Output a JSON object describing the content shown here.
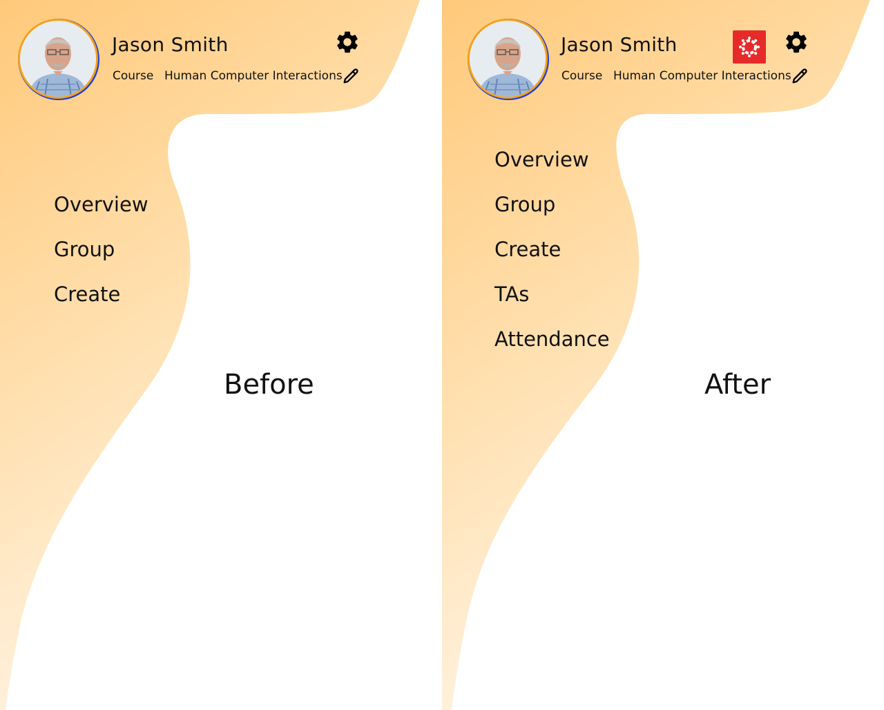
{
  "colors": {
    "gradient_top": "#ffc97a",
    "gradient_bottom": "#fff6ea",
    "avatar_ring": "#f4a21a",
    "avatar_shadow": "#1f3fd9",
    "canvas_red": "#e62a2a",
    "text": "#111111"
  },
  "before": {
    "profile": {
      "name": "Jason Smith",
      "course_label": "Course",
      "course_value": "Human Computer Interactions"
    },
    "icons": [
      "avatar",
      "gear-icon",
      "pencil-icon"
    ],
    "nav": [
      "Overview",
      "Group",
      "Create"
    ],
    "caption": "Before"
  },
  "after": {
    "profile": {
      "name": "Jason Smith",
      "course_label": "Course",
      "course_value": "Human Computer Interactions"
    },
    "icons": [
      "avatar",
      "canvas-lms-icon",
      "gear-icon",
      "pencil-icon"
    ],
    "nav": [
      "Overview",
      "Group",
      "Create",
      "TAs",
      "Attendance"
    ],
    "caption": "After"
  }
}
